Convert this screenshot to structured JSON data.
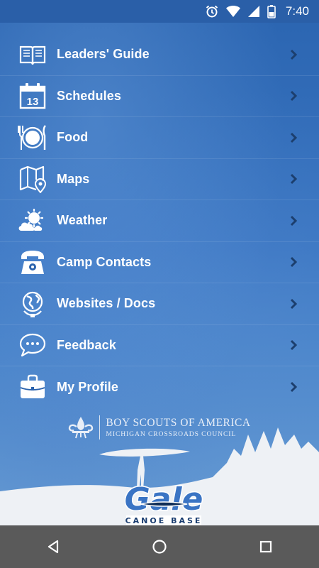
{
  "status_bar": {
    "time": "7:40",
    "icons": [
      "alarm-icon",
      "wifi-icon",
      "cell-signal-icon",
      "battery-icon"
    ]
  },
  "menu": {
    "items": [
      {
        "label": "Leaders' Guide",
        "icon": "book-icon"
      },
      {
        "label": "Schedules",
        "icon": "calendar-icon",
        "icon_text": "13"
      },
      {
        "label": "Food",
        "icon": "plate-utensils-icon"
      },
      {
        "label": "Maps",
        "icon": "map-icon"
      },
      {
        "label": "Weather",
        "icon": "weather-icon"
      },
      {
        "label": "Camp Contacts",
        "icon": "telephone-icon"
      },
      {
        "label": "Websites / Docs",
        "icon": "globe-icon"
      },
      {
        "label": "Feedback",
        "icon": "chat-bubble-icon"
      },
      {
        "label": "My Profile",
        "icon": "briefcase-icon"
      }
    ]
  },
  "footer": {
    "org_line1": "BOY SCOUTS OF AMERICA",
    "org_line2": "MICHIGAN CROSSROADS COUNCIL",
    "brand_name": "Gale",
    "brand_subtitle": "CANOE BASE"
  },
  "nav_bar": {
    "buttons": [
      "back-icon",
      "home-icon",
      "recents-icon"
    ]
  },
  "colors": {
    "background": "#2b63ad",
    "status_bar": "#2a5fa8",
    "nav_bar": "#5a5a5a",
    "text": "#ffffff"
  }
}
